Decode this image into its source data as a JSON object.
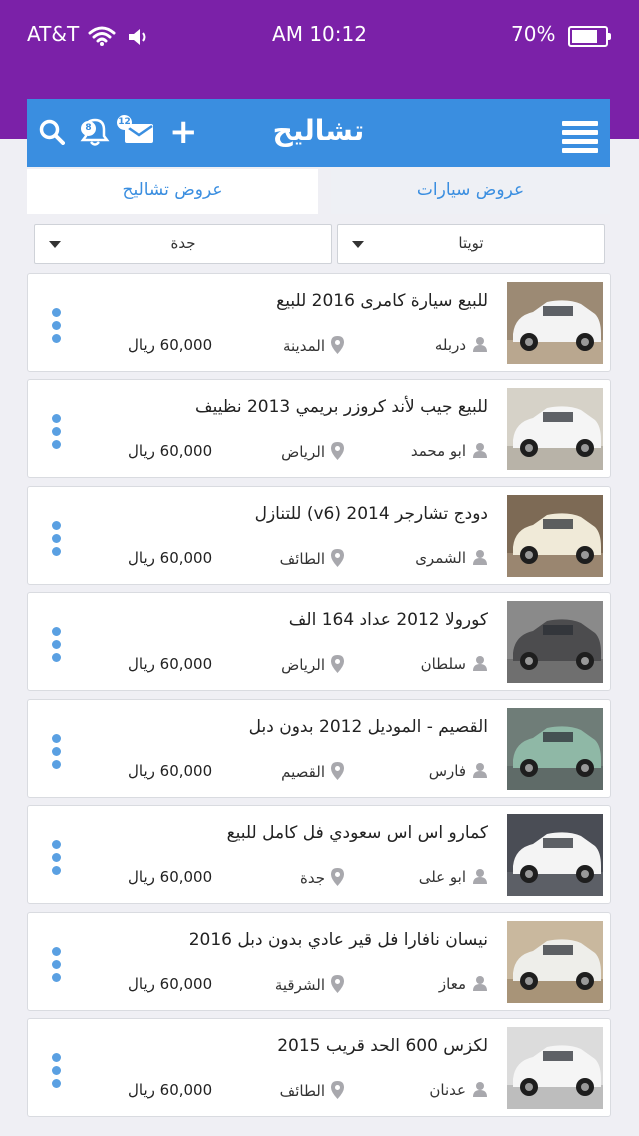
{
  "status": {
    "carrier": "AT&T",
    "time": "AM 10:12",
    "battery": "70%"
  },
  "nav": {
    "title": "تشاليح",
    "notification_count": "8",
    "message_count": "12",
    "add_label": "+"
  },
  "tabs": {
    "cars": "عروض سيارات",
    "scrap": "عروض تشاليح"
  },
  "filters": {
    "brand": "تويتا",
    "city": "جدة"
  },
  "listings": [
    {
      "title": "للبيع سيارة كامرى 2016 للبيع",
      "user": "دربله",
      "city": "المدينة",
      "price": "60,000 ريال",
      "thumb": {
        "sky": "#9c8a74",
        "body": "#f3f3f3",
        "ground": "#b9a78f"
      }
    },
    {
      "title": "للبيع جيب لأند كروزر بريمي 2013 نظييف",
      "user": "ابو محمد",
      "city": "الرياض",
      "price": "60,000 ريال",
      "thumb": {
        "sky": "#d6d2c8",
        "body": "#f5f5f5",
        "ground": "#b8b3a8"
      }
    },
    {
      "title": "دودج تشارجر 2014 (v6) للتنازل",
      "user": "الشمرى",
      "city": "الطائف",
      "price": "60,000 ريال",
      "thumb": {
        "sky": "#7d6a55",
        "body": "#f0ead8",
        "ground": "#9a8670"
      }
    },
    {
      "title": "كورولا 2012 عداد 164 الف",
      "user": "سلطان",
      "city": "الرياض",
      "price": "60,000 ريال",
      "thumb": {
        "sky": "#8a8a8a",
        "body": "#4c4c4e",
        "ground": "#6f6f6f"
      }
    },
    {
      "title": "القصيم - الموديل 2012 بدون دبل",
      "user": "فارس",
      "city": "القصيم",
      "price": "60,000 ريال",
      "thumb": {
        "sky": "#6f7d78",
        "body": "#8fb8a6",
        "ground": "#5f6b68"
      }
    },
    {
      "title": "كمارو اس اس سعودي فل كامل للبيع",
      "user": "ابو على",
      "city": "جدة",
      "price": "60,000 ريال",
      "thumb": {
        "sky": "#4a4d55",
        "body": "#f4f4f4",
        "ground": "#5c5f66"
      }
    },
    {
      "title": "نيسان نافارا فل قير عادي بدون دبل 2016",
      "user": "معاز",
      "city": "الشرقية",
      "price": "60,000 ريال",
      "thumb": {
        "sky": "#c9b89e",
        "body": "#eeeeea",
        "ground": "#a89478"
      }
    },
    {
      "title": "لكزس 600 الحد قريب 2015",
      "user": "عدنان",
      "city": "الطائف",
      "price": "60,000 ريال",
      "thumb": {
        "sky": "#dcdcdc",
        "body": "#f5f5f5",
        "ground": "#bdbdbd"
      }
    }
  ],
  "colors": {
    "status_bar": "#7b21a8",
    "nav_bar": "#3a8ee0",
    "menu_dots": "#5aa0e2"
  }
}
